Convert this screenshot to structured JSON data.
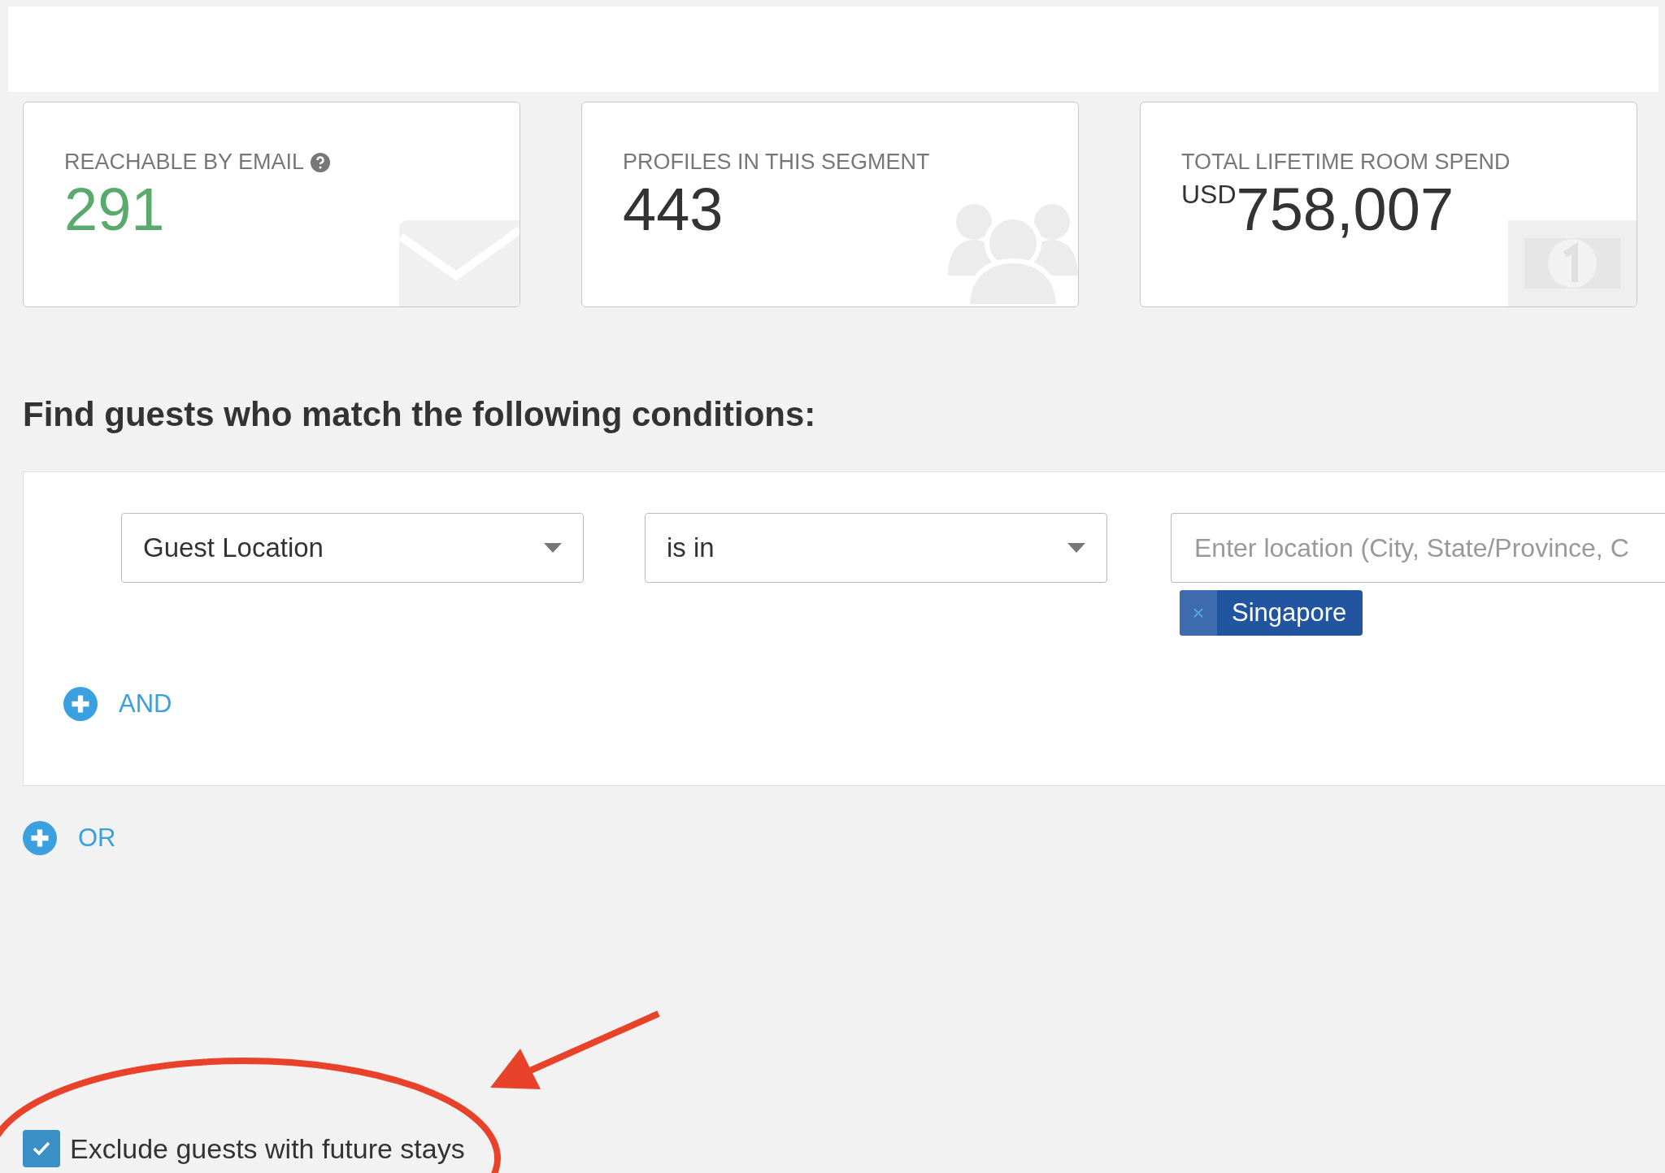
{
  "stats": [
    {
      "kind": "email",
      "label": "REACHABLE BY EMAIL",
      "help": true,
      "value": "291"
    },
    {
      "kind": "profiles",
      "label": "PROFILES IN THIS SEGMENT",
      "value": "443"
    },
    {
      "kind": "spend",
      "label": "TOTAL LIFETIME ROOM SPEND",
      "currency": "USD",
      "value": "758,007"
    }
  ],
  "heading": "Find guests who match the following conditions:",
  "condition": {
    "field": "Guest Location",
    "operator": "is in",
    "placeholder": "Enter location (City, State/Province, C",
    "tags": [
      {
        "label": "Singapore"
      }
    ]
  },
  "and_button": "AND",
  "or_button": "OR",
  "exclude_future_stays": {
    "label": "Exclude guests with future stays",
    "checked": true
  }
}
